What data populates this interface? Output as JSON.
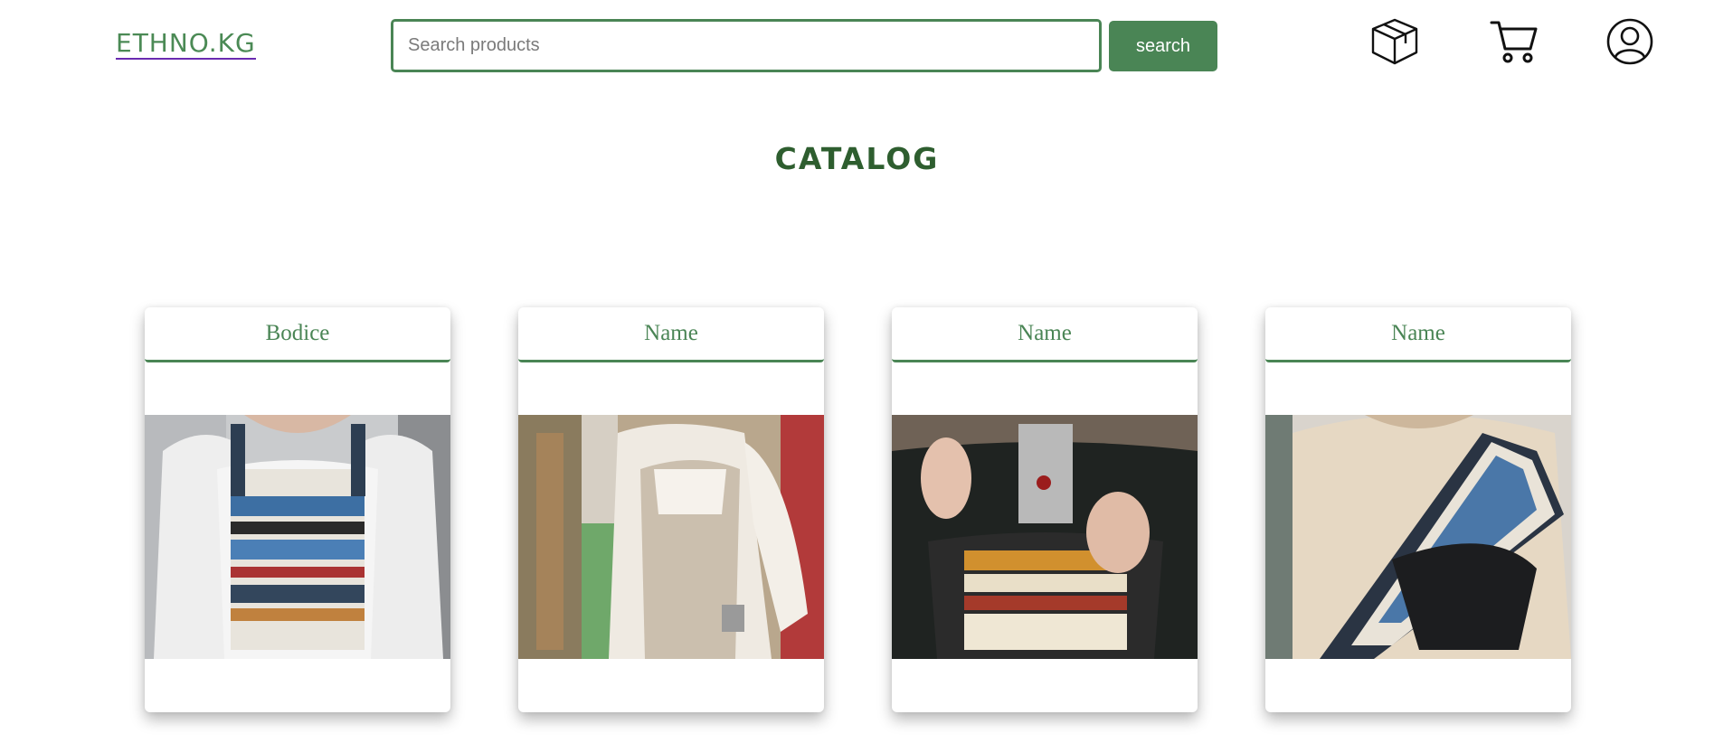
{
  "header": {
    "logo": "ETHNO.KG",
    "search_placeholder": "Search products",
    "search_value": "",
    "search_button": "search",
    "icons": [
      "package-icon",
      "cart-icon",
      "user-icon"
    ]
  },
  "main": {
    "title": "CATALOG",
    "products": [
      {
        "name": "Bodice",
        "image": "bodice-photo"
      },
      {
        "name": "Name",
        "image": "white-corset-photo"
      },
      {
        "name": "Name",
        "image": "black-dress-photo"
      },
      {
        "name": "Name",
        "image": "hoodie-bag-photo"
      }
    ]
  },
  "colors": {
    "accent": "#4a8555",
    "title": "#2e5e2f",
    "logo_underline": "#6a2bb0"
  }
}
